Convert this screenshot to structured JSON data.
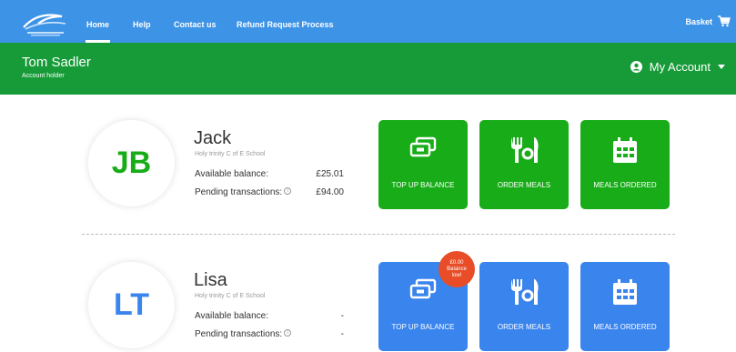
{
  "nav": {
    "items": [
      {
        "label": "Home"
      },
      {
        "label": "Help"
      },
      {
        "label": "Contact us"
      },
      {
        "label": "Refund Request Process"
      }
    ],
    "basket_label": "Basket"
  },
  "account": {
    "holder_name": "Tom Sadler",
    "holder_role": "Account holder",
    "my_account_label": "My Account"
  },
  "children": [
    {
      "initials": "JB",
      "name": "Jack",
      "school": "Holy trinity C of E School",
      "available_label": "Available balance:",
      "available_value": "£25.01",
      "pending_label": "Pending transactions:",
      "pending_value": "£94.00",
      "accent": "#18ad18",
      "tiles": [
        "TOP UP BALANCE",
        "ORDER MEALS",
        "MEALS ORDERED"
      ]
    },
    {
      "initials": "LT",
      "name": "Lisa",
      "school": "Holy trinity C of E School",
      "available_label": "Available balance:",
      "available_value": "-",
      "pending_label": "Pending transactions:",
      "pending_value": "-",
      "accent": "#3a84ee",
      "badge_amount": "£0.00",
      "badge_line1": "Balance",
      "badge_line2": "low!",
      "tiles": [
        "TOP UP BALANCE",
        "ORDER MEALS",
        "MEALS ORDERED"
      ]
    }
  ],
  "colors": {
    "nav_blue": "#3d93e6",
    "header_green": "#169b38",
    "tile_green": "#18ad18",
    "tile_blue": "#3a84ee",
    "badge_red": "#e84d28"
  },
  "icons": [
    "logo-icon",
    "basket-icon",
    "user-circle-icon",
    "chevron-down-icon",
    "money-icon",
    "cutlery-icon",
    "calendar-icon",
    "info-icon"
  ]
}
